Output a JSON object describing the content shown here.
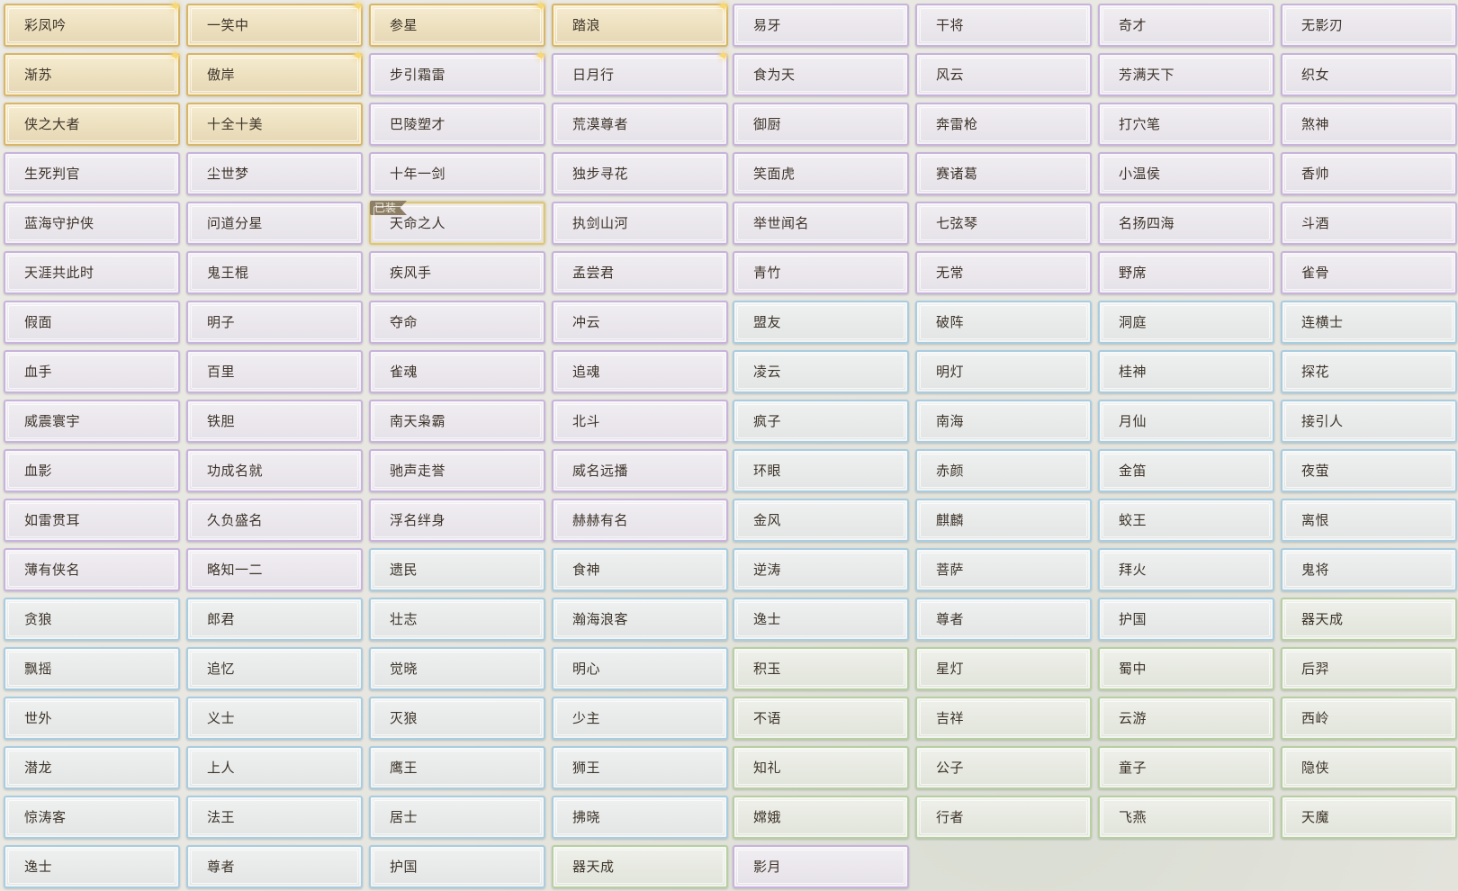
{
  "colors": {
    "gold": "#d7b66a",
    "purple": "#c7b3dc",
    "blue": "#a9cde0",
    "green": "#b7cfa2",
    "text": "#3d3329",
    "badge": "#8d7f66"
  },
  "equipped_badge": "已装",
  "columns": [
    [
      {
        "label": "彩凤吟",
        "rarity": "gold",
        "sparkle": true
      },
      {
        "label": "渐苏",
        "rarity": "gold",
        "sparkle": true
      },
      {
        "label": "侠之大者",
        "rarity": "gold"
      },
      {
        "label": "生死判官",
        "rarity": "purple"
      },
      {
        "label": "蓝海守护侠",
        "rarity": "purple"
      },
      {
        "label": "天涯共此时",
        "rarity": "purple"
      },
      {
        "label": "假面",
        "rarity": "purple"
      },
      {
        "label": "血手",
        "rarity": "purple"
      },
      {
        "label": "威震寰宇",
        "rarity": "purple"
      },
      {
        "label": "血影",
        "rarity": "purple"
      },
      {
        "label": "如雷贯耳",
        "rarity": "purple"
      },
      {
        "label": "薄有侠名",
        "rarity": "purple"
      },
      {
        "label": "贪狼",
        "rarity": "blue"
      },
      {
        "label": "飘摇",
        "rarity": "blue"
      },
      {
        "label": "世外",
        "rarity": "blue"
      },
      {
        "label": "潜龙",
        "rarity": "blue"
      },
      {
        "label": "惊涛客",
        "rarity": "blue"
      },
      {
        "label": "逸士",
        "rarity": "blue"
      }
    ],
    [
      {
        "label": "一笑中",
        "rarity": "gold",
        "sparkle": true
      },
      {
        "label": "傲岸",
        "rarity": "gold",
        "sparkle": true
      },
      {
        "label": "十全十美",
        "rarity": "gold"
      },
      {
        "label": "尘世梦",
        "rarity": "purple"
      },
      {
        "label": "问道分星",
        "rarity": "purple"
      },
      {
        "label": "鬼王棍",
        "rarity": "purple"
      },
      {
        "label": "明子",
        "rarity": "purple"
      },
      {
        "label": "百里",
        "rarity": "purple"
      },
      {
        "label": "铁胆",
        "rarity": "purple"
      },
      {
        "label": "功成名就",
        "rarity": "purple"
      },
      {
        "label": "久负盛名",
        "rarity": "purple"
      },
      {
        "label": "略知一二",
        "rarity": "purple"
      },
      {
        "label": "郎君",
        "rarity": "blue"
      },
      {
        "label": "追忆",
        "rarity": "blue"
      },
      {
        "label": "义士",
        "rarity": "blue"
      },
      {
        "label": "上人",
        "rarity": "blue"
      },
      {
        "label": "法王",
        "rarity": "blue"
      },
      {
        "label": "尊者",
        "rarity": "blue"
      }
    ],
    [
      {
        "label": "参星",
        "rarity": "gold",
        "sparkle": true
      },
      {
        "label": "步引霜雷",
        "rarity": "purple",
        "sparkle": true
      },
      {
        "label": "巴陵塑才",
        "rarity": "purple"
      },
      {
        "label": "十年一剑",
        "rarity": "purple"
      },
      {
        "label": "天命之人",
        "rarity": "purple",
        "equipped": true
      },
      {
        "label": "疾风手",
        "rarity": "purple"
      },
      {
        "label": "夺命",
        "rarity": "purple"
      },
      {
        "label": "雀魂",
        "rarity": "purple"
      },
      {
        "label": "南天枭霸",
        "rarity": "purple"
      },
      {
        "label": "驰声走誉",
        "rarity": "purple"
      },
      {
        "label": "浮名绊身",
        "rarity": "purple"
      },
      {
        "label": "遗民",
        "rarity": "blue"
      },
      {
        "label": "壮志",
        "rarity": "blue"
      },
      {
        "label": "觉晓",
        "rarity": "blue"
      },
      {
        "label": "灭狼",
        "rarity": "blue"
      },
      {
        "label": "鹰王",
        "rarity": "blue"
      },
      {
        "label": "居士",
        "rarity": "blue"
      },
      {
        "label": "护国",
        "rarity": "blue"
      }
    ],
    [
      {
        "label": "踏浪",
        "rarity": "gold",
        "sparkle": true
      },
      {
        "label": "日月行",
        "rarity": "purple",
        "sparkle": true
      },
      {
        "label": "荒漠尊者",
        "rarity": "purple"
      },
      {
        "label": "独步寻花",
        "rarity": "purple"
      },
      {
        "label": "执剑山河",
        "rarity": "purple"
      },
      {
        "label": "孟尝君",
        "rarity": "purple"
      },
      {
        "label": "冲云",
        "rarity": "purple"
      },
      {
        "label": "追魂",
        "rarity": "purple"
      },
      {
        "label": "北斗",
        "rarity": "purple"
      },
      {
        "label": "威名远播",
        "rarity": "purple"
      },
      {
        "label": "赫赫有名",
        "rarity": "purple"
      },
      {
        "label": "食神",
        "rarity": "blue"
      },
      {
        "label": "瀚海浪客",
        "rarity": "blue"
      },
      {
        "label": "明心",
        "rarity": "blue"
      },
      {
        "label": "少主",
        "rarity": "blue"
      },
      {
        "label": "狮王",
        "rarity": "blue"
      },
      {
        "label": "拂晓",
        "rarity": "blue"
      },
      {
        "label": "器天成",
        "rarity": "green"
      }
    ],
    [
      {
        "label": "易牙",
        "rarity": "purple"
      },
      {
        "label": "食为天",
        "rarity": "purple"
      },
      {
        "label": "御厨",
        "rarity": "purple"
      },
      {
        "label": "笑面虎",
        "rarity": "purple"
      },
      {
        "label": "举世闻名",
        "rarity": "purple"
      },
      {
        "label": "青竹",
        "rarity": "purple"
      },
      {
        "label": "盟友",
        "rarity": "blue"
      },
      {
        "label": "凌云",
        "rarity": "blue"
      },
      {
        "label": "疯子",
        "rarity": "blue"
      },
      {
        "label": "环眼",
        "rarity": "blue"
      },
      {
        "label": "金风",
        "rarity": "blue"
      },
      {
        "label": "逆涛",
        "rarity": "blue"
      },
      {
        "label": "逸士",
        "rarity": "blue"
      },
      {
        "label": "积玉",
        "rarity": "green"
      },
      {
        "label": "不语",
        "rarity": "green"
      },
      {
        "label": "知礼",
        "rarity": "green"
      },
      {
        "label": "嫦娥",
        "rarity": "green"
      },
      {
        "label": "影月",
        "rarity": "purple"
      }
    ],
    [
      {
        "label": "干将",
        "rarity": "purple"
      },
      {
        "label": "风云",
        "rarity": "purple"
      },
      {
        "label": "奔雷枪",
        "rarity": "purple"
      },
      {
        "label": "赛诸葛",
        "rarity": "purple"
      },
      {
        "label": "七弦琴",
        "rarity": "purple"
      },
      {
        "label": "无常",
        "rarity": "purple"
      },
      {
        "label": "破阵",
        "rarity": "blue"
      },
      {
        "label": "明灯",
        "rarity": "blue"
      },
      {
        "label": "南海",
        "rarity": "blue"
      },
      {
        "label": "赤颜",
        "rarity": "blue"
      },
      {
        "label": "麒麟",
        "rarity": "blue"
      },
      {
        "label": "菩萨",
        "rarity": "blue"
      },
      {
        "label": "尊者",
        "rarity": "blue"
      },
      {
        "label": "星灯",
        "rarity": "green"
      },
      {
        "label": "吉祥",
        "rarity": "green"
      },
      {
        "label": "公子",
        "rarity": "green"
      },
      {
        "label": "行者",
        "rarity": "green"
      }
    ],
    [
      {
        "label": "奇才",
        "rarity": "purple"
      },
      {
        "label": "芳满天下",
        "rarity": "purple"
      },
      {
        "label": "打穴笔",
        "rarity": "purple"
      },
      {
        "label": "小温侯",
        "rarity": "purple"
      },
      {
        "label": "名扬四海",
        "rarity": "purple"
      },
      {
        "label": "野席",
        "rarity": "purple"
      },
      {
        "label": "洞庭",
        "rarity": "blue"
      },
      {
        "label": "桂神",
        "rarity": "blue"
      },
      {
        "label": "月仙",
        "rarity": "blue"
      },
      {
        "label": "金笛",
        "rarity": "blue"
      },
      {
        "label": "蛟王",
        "rarity": "blue"
      },
      {
        "label": "拜火",
        "rarity": "blue"
      },
      {
        "label": "护国",
        "rarity": "blue"
      },
      {
        "label": "蜀中",
        "rarity": "green"
      },
      {
        "label": "云游",
        "rarity": "green"
      },
      {
        "label": "童子",
        "rarity": "green"
      },
      {
        "label": "飞燕",
        "rarity": "green"
      }
    ],
    [
      {
        "label": "无影刃",
        "rarity": "purple"
      },
      {
        "label": "织女",
        "rarity": "purple"
      },
      {
        "label": "煞神",
        "rarity": "purple"
      },
      {
        "label": "香帅",
        "rarity": "purple"
      },
      {
        "label": "斗酒",
        "rarity": "purple"
      },
      {
        "label": "雀骨",
        "rarity": "purple"
      },
      {
        "label": "连横士",
        "rarity": "blue"
      },
      {
        "label": "探花",
        "rarity": "blue"
      },
      {
        "label": "接引人",
        "rarity": "blue"
      },
      {
        "label": "夜萤",
        "rarity": "blue"
      },
      {
        "label": "离恨",
        "rarity": "blue"
      },
      {
        "label": "鬼将",
        "rarity": "blue"
      },
      {
        "label": "器天成",
        "rarity": "green"
      },
      {
        "label": "后羿",
        "rarity": "green"
      },
      {
        "label": "西岭",
        "rarity": "green"
      },
      {
        "label": "隐侠",
        "rarity": "green"
      },
      {
        "label": "天魔",
        "rarity": "green"
      }
    ]
  ]
}
